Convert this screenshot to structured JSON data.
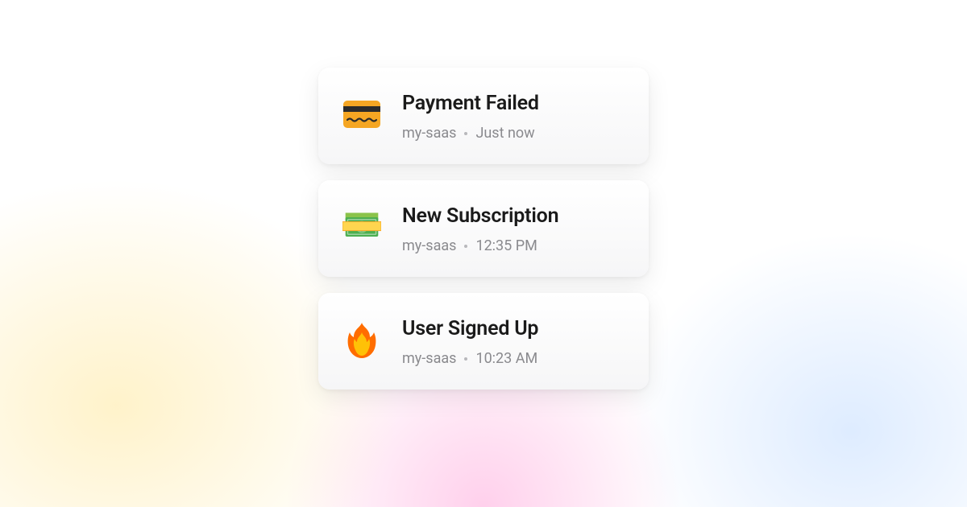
{
  "notifications": [
    {
      "icon": "credit-card-icon",
      "title": "Payment Failed",
      "source": "my-saas",
      "time": "Just now"
    },
    {
      "icon": "money-icon",
      "title": "New Subscription",
      "source": "my-saas",
      "time": "12:35 PM"
    },
    {
      "icon": "fire-icon",
      "title": "User Signed Up",
      "source": "my-saas",
      "time": "10:23 AM"
    }
  ]
}
